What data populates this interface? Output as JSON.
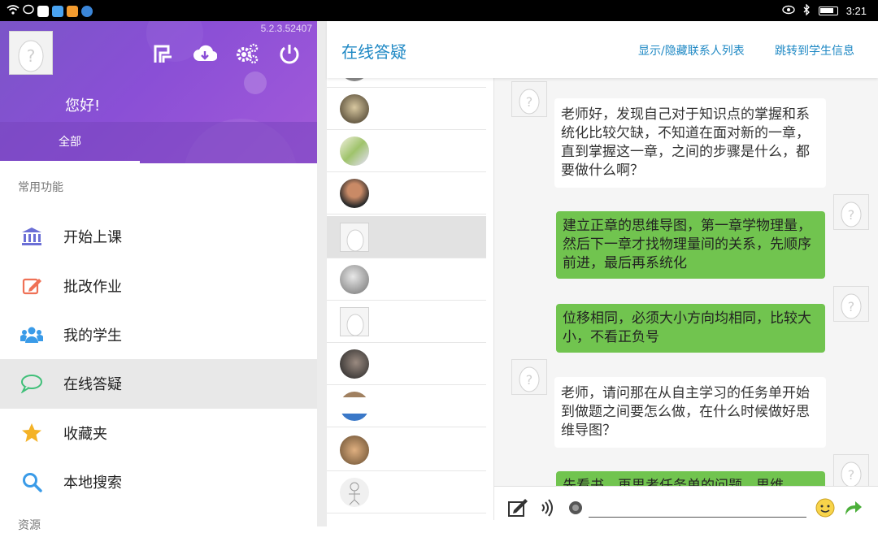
{
  "status_bar": {
    "time": "3:21"
  },
  "drawer": {
    "version": "5.2.3.52407",
    "greeting": "您好!",
    "tab_all": "全部",
    "section_common": "常用功能",
    "section_resource": "资源",
    "menu": [
      {
        "label": "开始上课",
        "icon": "bank-icon",
        "color": "#6b6fd6"
      },
      {
        "label": "批改作业",
        "icon": "edit-icon",
        "color": "#ef7156"
      },
      {
        "label": "我的学生",
        "icon": "users-icon",
        "color": "#3a9be8"
      },
      {
        "label": "在线答疑",
        "icon": "chat-icon",
        "color": "#3fbf78"
      },
      {
        "label": "收藏夹",
        "icon": "star-icon",
        "color": "#f4b226"
      },
      {
        "label": "本地搜索",
        "icon": "search-icon",
        "color": "#3a9be8"
      }
    ]
  },
  "topbar": {
    "title": "在线答疑",
    "toggle_contacts": "显示/隐藏联系人列表",
    "jump_student": "跳转到学生信息"
  },
  "chat": {
    "messages": [
      {
        "side": "left",
        "text": "老师好，发现自己对于知识点的掌握和系统化比较欠缺，不知道在面对新的一章，直到掌握这一章，之间的步骤是什么，都要做什么啊？"
      },
      {
        "side": "right",
        "text": "建立正章的思维导图，第一章学物理量，然后下一章才找物理量间的关系，先顺序前进，最后再系统化"
      },
      {
        "side": "right",
        "text": "位移相同，必须大小方向均相同，比较大小，不看正负号"
      },
      {
        "side": "left",
        "text": "老师，请问那在从自主学习的任务单开始到做题之间要怎么做，在什么时候做好思维导图？"
      },
      {
        "side": "right",
        "text": "先看书，再思考任务单的问题，思维"
      }
    ]
  },
  "colors": {
    "accent": "#1e88c4",
    "bubble_green": "#71c44f",
    "header_purple": "#8a4fd6"
  }
}
